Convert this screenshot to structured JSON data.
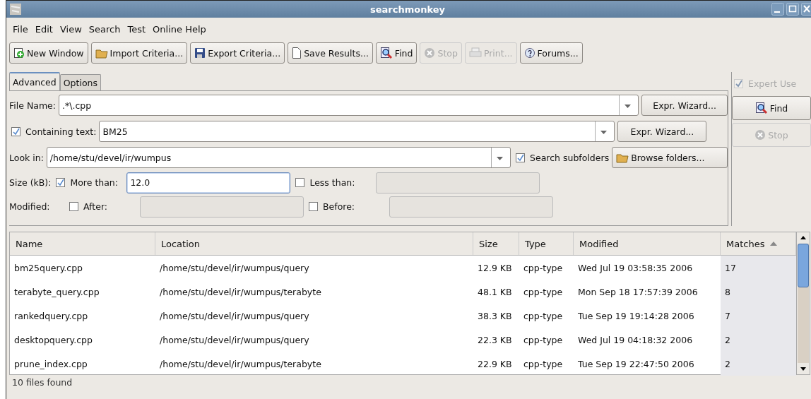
{
  "window": {
    "title": "searchmonkey"
  },
  "menu": [
    "File",
    "Edit",
    "View",
    "Search",
    "Test",
    "Online Help"
  ],
  "toolbar": [
    {
      "label": "New Window",
      "kind": "new",
      "disabled": false
    },
    {
      "label": "Import Criteria...",
      "kind": "folder",
      "disabled": false
    },
    {
      "label": "Export Criteria...",
      "kind": "save",
      "disabled": false
    },
    {
      "label": "Save Results...",
      "kind": "page",
      "disabled": false
    },
    {
      "label": "Find",
      "kind": "find",
      "disabled": false
    },
    {
      "label": "Stop",
      "kind": "stop",
      "disabled": true
    },
    {
      "label": "Print...",
      "kind": "print",
      "disabled": true
    },
    {
      "label": "Forums...",
      "kind": "help",
      "disabled": false
    }
  ],
  "tabs": [
    {
      "label": "Advanced",
      "selected": true
    },
    {
      "label": "Options",
      "selected": false
    }
  ],
  "expert_user": {
    "label": "Expert Use",
    "checked": true,
    "disabled": true
  },
  "side_buttons": [
    {
      "label": "Find",
      "kind": "find",
      "disabled": false
    },
    {
      "label": "Stop",
      "kind": "stop",
      "disabled": true
    }
  ],
  "file_name": {
    "label": "File Name:",
    "value": ".*\\.cpp",
    "button": "Expr. Wizard..."
  },
  "containing_text": {
    "label": "Containing text:",
    "checked": true,
    "value": "BM25",
    "button": "Expr. Wizard..."
  },
  "look_in": {
    "label": "Look in:",
    "value": "/home/stu/devel/ir/wumpus",
    "subfolders": {
      "label": "Search subfolders",
      "checked": true
    },
    "button": "Browse folders..."
  },
  "size": {
    "label": "Size (kB):",
    "more": {
      "label": "More than:",
      "checked": true,
      "value": "12.0"
    },
    "less": {
      "label": "Less than:",
      "checked": false
    }
  },
  "modified": {
    "label": "Modified:",
    "after": {
      "label": "After:",
      "checked": false
    },
    "before": {
      "label": "Before:",
      "checked": false
    }
  },
  "table": {
    "columns": [
      {
        "label": "Name",
        "sorted": false
      },
      {
        "label": "Location",
        "sorted": false
      },
      {
        "label": "Size",
        "sorted": false
      },
      {
        "label": "Type",
        "sorted": false
      },
      {
        "label": "Modified",
        "sorted": false
      },
      {
        "label": "Matches",
        "sorted": true
      }
    ],
    "rows": [
      [
        "bm25query.cpp",
        "/home/stu/devel/ir/wumpus/query",
        "12.9 KB",
        "cpp-type",
        "Wed Jul 19 03:58:35 2006",
        "17"
      ],
      [
        "terabyte_query.cpp",
        "/home/stu/devel/ir/wumpus/terabyte",
        "48.1 KB",
        "cpp-type",
        "Mon Sep 18 17:57:39 2006",
        "8"
      ],
      [
        "rankedquery.cpp",
        "/home/stu/devel/ir/wumpus/query",
        "38.3 KB",
        "cpp-type",
        "Tue Sep 19 19:14:28 2006",
        "7"
      ],
      [
        "desktopquery.cpp",
        "/home/stu/devel/ir/wumpus/query",
        "22.3 KB",
        "cpp-type",
        "Wed Jul 19 04:18:32 2006",
        "2"
      ],
      [
        "prune_index.cpp",
        "/home/stu/devel/ir/wumpus/terabyte",
        "22.9 KB",
        "cpp-type",
        "Tue Sep 19 22:47:50 2006",
        "2"
      ]
    ]
  },
  "status_bar": "10 files found"
}
